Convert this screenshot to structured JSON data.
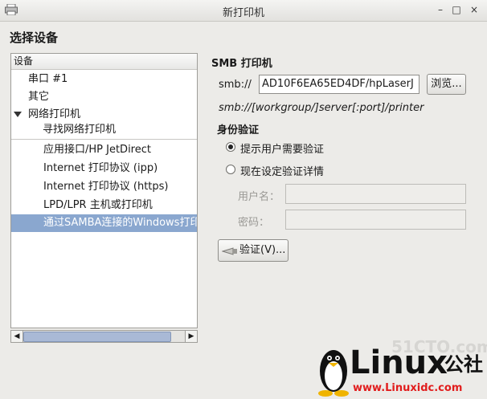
{
  "window": {
    "title": "新打印机"
  },
  "heading": "选择设备",
  "device_list": {
    "column_header": "设备",
    "rows": [
      {
        "label": "串口 #1"
      },
      {
        "label": "其它"
      },
      {
        "label": "网络打印机"
      },
      {
        "label": "寻找网络打印机"
      },
      {
        "label": "应用接口/HP JetDirect"
      },
      {
        "label": "Internet 打印协议 (ipp)"
      },
      {
        "label": "Internet 打印协议 (https)"
      },
      {
        "label": "LPD/LPR 主机或打印机"
      },
      {
        "label": "通过SAMBA连接的Windows打印"
      }
    ],
    "selected_index": 8
  },
  "smb": {
    "heading": "SMB 打印机",
    "prefix": "smb://",
    "value": "AD10F6EA65ED4DF/hpLaserJ",
    "browse_label": "浏览...",
    "hint": "smb://[workgroup/]server[:port]/printer"
  },
  "auth": {
    "heading": "身份验证",
    "option_prompt": "提示用户需要验证",
    "option_set_now": "现在设定验证详情",
    "selected": "prompt",
    "username_label": "用户名：",
    "password_label": "密码：",
    "verify_label": "验证(V)..."
  },
  "watermark": {
    "brand": "Linux",
    "brand_cn": "公社",
    "url": "www.Linuxidc.com",
    "faint": "51CTO.com"
  },
  "colors": {
    "selection": "#8aa7cf",
    "watermark_red": "#e11d1d"
  }
}
